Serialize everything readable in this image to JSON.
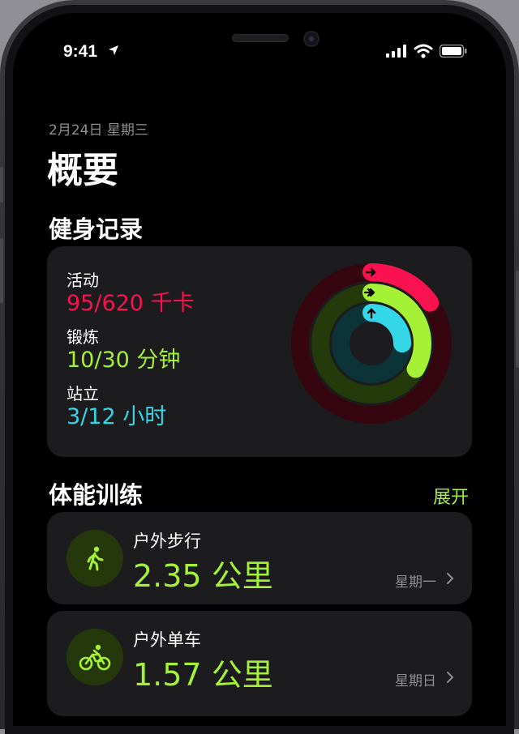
{
  "status_bar": {
    "time": "9:41"
  },
  "summary": {
    "date": "2月24日 星期三",
    "title": "概要"
  },
  "activity": {
    "section_title": "健身记录",
    "rings": [
      {
        "label": "活动",
        "value": "95/620 千卡",
        "progress": 0.153,
        "color": "#fa114f"
      },
      {
        "label": "锻炼",
        "value": "10/30 分钟",
        "progress": 0.333,
        "color": "#a4f136"
      },
      {
        "label": "站立",
        "value": "3/12 小时",
        "progress": 0.25,
        "color": "#34d7e8"
      }
    ]
  },
  "workouts": {
    "section_title": "体能训练",
    "expand_label": "展开",
    "items": [
      {
        "name": "户外步行",
        "value": "2.35 公里",
        "day": "星期一",
        "icon": "walking-icon"
      },
      {
        "name": "户外单车",
        "value": "1.57 公里",
        "day": "星期日",
        "icon": "cycling-icon"
      }
    ]
  },
  "colors": {
    "move": "#fa114f",
    "exercise": "#a4f136",
    "stand": "#34d7e8",
    "card": "#1c1c1e"
  }
}
